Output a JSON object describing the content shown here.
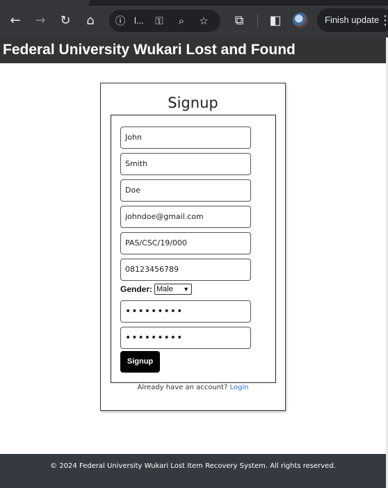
{
  "browser": {
    "back_glyph": "←",
    "forward_glyph": "→",
    "reload_glyph": "↻",
    "home_glyph": "⌂",
    "info_glyph": "ⓘ",
    "url_text": "l...",
    "key_glyph": "⚿",
    "zoom_glyph": "⌕",
    "star_glyph": "☆",
    "extensions_glyph": "⧉",
    "sidepanel_glyph": "◧",
    "update_label": "Finish update",
    "menu_glyph": "⋮",
    "icons": [
      "arrow-left-icon",
      "arrow-right-icon",
      "reload-icon",
      "home-icon",
      "site-info-icon",
      "key-icon",
      "zoom-icon",
      "star-icon",
      "puzzle-icon",
      "side-panel-icon",
      "profile-avatar",
      "three-dots-icon"
    ]
  },
  "site": {
    "title": "Federal University Wukari Lost and Found"
  },
  "signup": {
    "heading": "Signup",
    "fields": {
      "first_name": "John",
      "middle_name": "Smith",
      "last_name": "Doe",
      "email": "johndoe@gmail.com",
      "reg_number": "PAS/CSC/19/000",
      "phone": "08123456789",
      "password": "•••••••••",
      "confirm_password": "•••••••••"
    },
    "gender_label": "Gender:",
    "gender_value": "Male",
    "gender_caret": "▼",
    "submit_label": "Signup",
    "have_account_text": "Already have an account?",
    "login_link": "Login"
  },
  "footer": {
    "text": "© 2024 Federal University Wukari Lost Item Recovery System. All rights reserved."
  },
  "colors": {
    "browser_bar": "#35363a",
    "header_bg": "#333333",
    "footer_bg": "#343a40",
    "link": "#2a6ad1",
    "button_bg": "#000000"
  }
}
